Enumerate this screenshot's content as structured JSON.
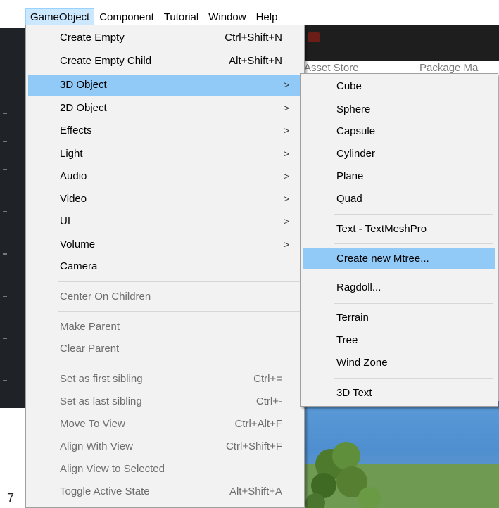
{
  "menubar": {
    "items": [
      {
        "label": "GameObject",
        "active": true
      },
      {
        "label": "Component",
        "active": false
      },
      {
        "label": "Tutorial",
        "active": false
      },
      {
        "label": "Window",
        "active": false
      },
      {
        "label": "Help",
        "active": false
      }
    ]
  },
  "background": {
    "tab_asset_store": "Asset Store",
    "tab_package_manager": "Package Ma",
    "corner_glyph": "7"
  },
  "main_menu": {
    "items": [
      {
        "label": "Create Empty",
        "shortcut": "Ctrl+Shift+N"
      },
      {
        "label": "Create Empty Child",
        "shortcut": "Alt+Shift+N"
      },
      {
        "label": "3D Object",
        "arrow": ">"
      },
      {
        "label": "2D Object",
        "arrow": ">"
      },
      {
        "label": "Effects",
        "arrow": ">"
      },
      {
        "label": "Light",
        "arrow": ">"
      },
      {
        "label": "Audio",
        "arrow": ">"
      },
      {
        "label": "Video",
        "arrow": ">"
      },
      {
        "label": "UI",
        "arrow": ">"
      },
      {
        "label": "Volume",
        "arrow": ">"
      },
      {
        "label": "Camera"
      },
      {
        "label": "Center On Children"
      },
      {
        "label": "Make Parent"
      },
      {
        "label": "Clear Parent"
      },
      {
        "label": "Set as first sibling",
        "shortcut": "Ctrl+="
      },
      {
        "label": "Set as last sibling",
        "shortcut": "Ctrl+-"
      },
      {
        "label": "Move To View",
        "shortcut": "Ctrl+Alt+F"
      },
      {
        "label": "Align With View",
        "shortcut": "Ctrl+Shift+F"
      },
      {
        "label": "Align View to Selected"
      },
      {
        "label": "Toggle Active State",
        "shortcut": "Alt+Shift+A"
      }
    ]
  },
  "submenu_3d_object": {
    "items": [
      {
        "label": "Cube"
      },
      {
        "label": "Sphere"
      },
      {
        "label": "Capsule"
      },
      {
        "label": "Cylinder"
      },
      {
        "label": "Plane"
      },
      {
        "label": "Quad"
      },
      {
        "label": "Text - TextMeshPro"
      },
      {
        "label": "Create new Mtree..."
      },
      {
        "label": "Ragdoll..."
      },
      {
        "label": "Terrain"
      },
      {
        "label": "Tree"
      },
      {
        "label": "Wind Zone"
      },
      {
        "label": "3D Text"
      }
    ]
  },
  "colors": {
    "highlight": "#91c9f7",
    "menu_bg": "#f2f2f2",
    "active_menubar": "#cce8ff",
    "disabled_text": "#6d6d6d"
  }
}
